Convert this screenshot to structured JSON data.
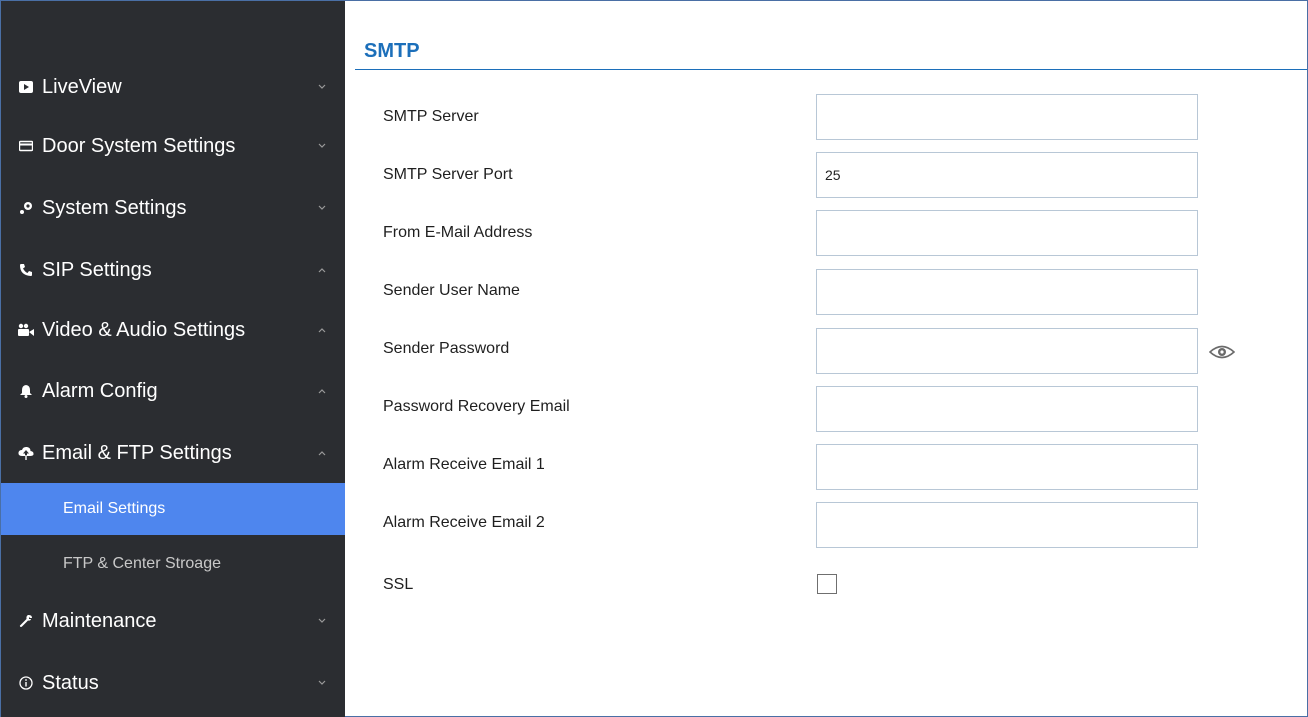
{
  "sidebar": {
    "items": [
      {
        "label": "LiveView",
        "icon": "video-icon",
        "chevron": "down"
      },
      {
        "label": "Door System Settings",
        "icon": "card-icon",
        "chevron": "down"
      },
      {
        "label": "System Settings",
        "icon": "wrench-gear-icon",
        "chevron": "down"
      },
      {
        "label": "SIP Settings",
        "icon": "phone-icon",
        "chevron": "up"
      },
      {
        "label": "Video & Audio Settings",
        "icon": "camera-icon",
        "chevron": "up"
      },
      {
        "label": "Alarm Config",
        "icon": "bell-icon",
        "chevron": "up"
      },
      {
        "label": "Email & FTP Settings",
        "icon": "cloud-upload-icon",
        "chevron": "up"
      },
      {
        "label": "Maintenance",
        "icon": "wrench-icon",
        "chevron": "down"
      },
      {
        "label": "Status",
        "icon": "info-icon",
        "chevron": "down"
      }
    ],
    "subitems": [
      {
        "label": "Email Settings",
        "active": true
      },
      {
        "label": "FTP & Center Stroage",
        "active": false
      }
    ],
    "active_color": "#4e86ee",
    "background_color": "#2b2d31"
  },
  "main": {
    "title": "SMTP",
    "fields": [
      {
        "label": "SMTP Server",
        "value": ""
      },
      {
        "label": "SMTP Server Port",
        "value": "25"
      },
      {
        "label": "From E-Mail Address",
        "value": ""
      },
      {
        "label": "Sender User Name",
        "value": ""
      },
      {
        "label": "Sender Password",
        "value": ""
      },
      {
        "label": "Password Recovery Email",
        "value": ""
      },
      {
        "label": "Alarm Receive Email 1",
        "value": ""
      },
      {
        "label": "Alarm Receive Email 2",
        "value": ""
      }
    ],
    "ssl": {
      "label": "SSL",
      "checked": false
    },
    "accent_color": "#1c6fba"
  }
}
